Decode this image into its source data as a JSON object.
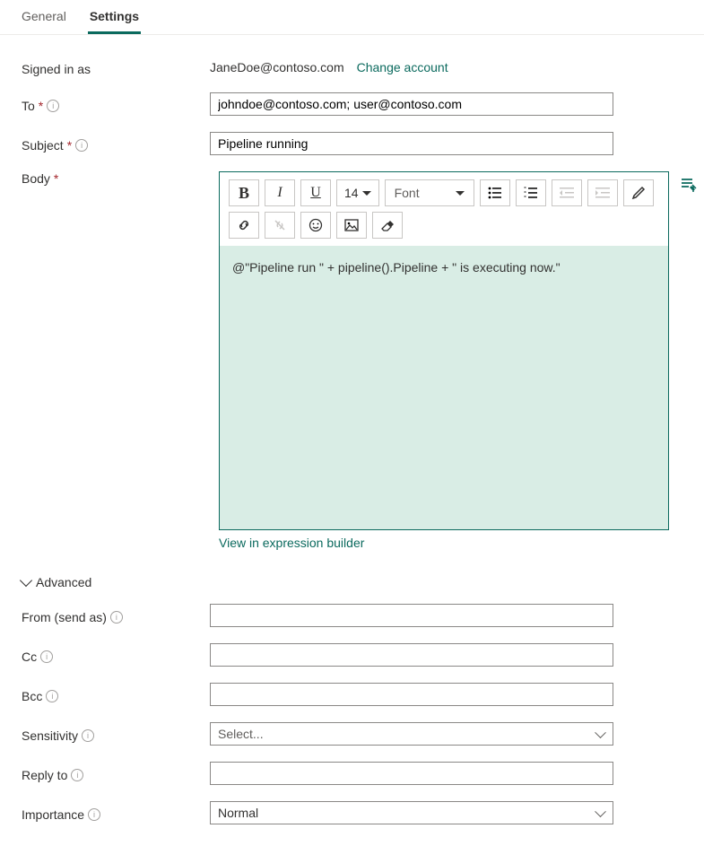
{
  "tabs": {
    "general": "General",
    "settings": "Settings"
  },
  "labels": {
    "signed_in": "Signed in as",
    "to": "To",
    "subject": "Subject",
    "body": "Body",
    "advanced": "Advanced",
    "from": "From (send as)",
    "cc": "Cc",
    "bcc": "Bcc",
    "sensitivity": "Sensitivity",
    "reply_to": "Reply to",
    "importance": "Importance"
  },
  "signed_in_email": "JaneDoe@contoso.com",
  "change_account": "Change account",
  "to_value": "johndoe@contoso.com; user@contoso.com",
  "subject_value": "Pipeline running",
  "editor": {
    "fontsize": "14",
    "font_placeholder": "Font",
    "body_text": "@\"Pipeline run \" + pipeline().Pipeline + \" is executing now.\""
  },
  "view_expression": "View in expression builder",
  "from_value": "",
  "cc_value": "",
  "bcc_value": "",
  "sensitivity_placeholder": "Select...",
  "reply_to_value": "",
  "importance_value": "Normal"
}
